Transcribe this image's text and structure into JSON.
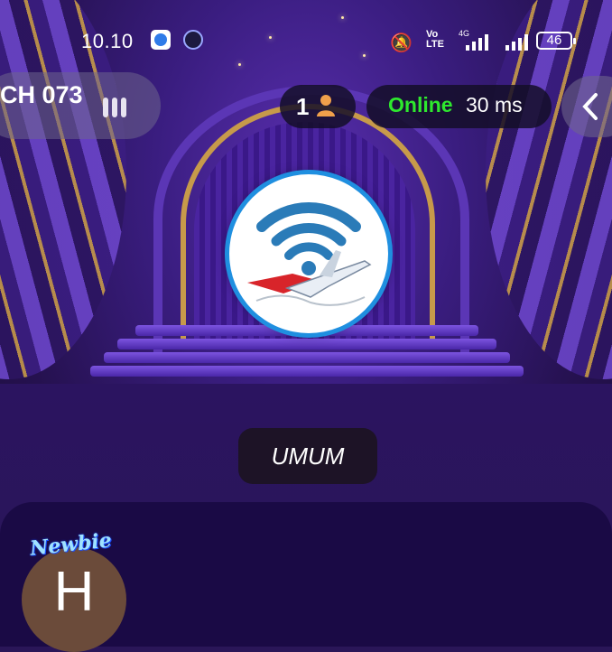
{
  "status_bar": {
    "time": "10.10",
    "volte": "Vo\nLTE",
    "network_tag": "4G",
    "battery": "46"
  },
  "room": {
    "name": "CH 073"
  },
  "header": {
    "user_count": "1",
    "status": "Online",
    "latency": "30 ms"
  },
  "category": "UMUM",
  "seat": {
    "avatar_letter": "H",
    "badge": "Newbie"
  },
  "colors": {
    "online": "#2ee82e",
    "panel": "#1a0a45",
    "accent_blue": "#1f8fe0"
  }
}
